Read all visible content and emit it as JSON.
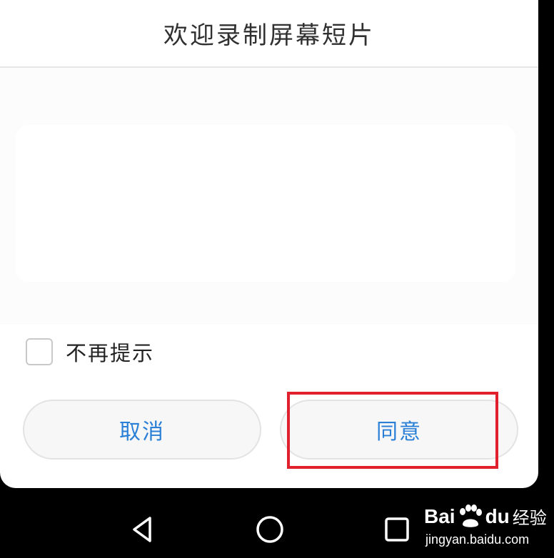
{
  "dialog": {
    "title": "欢迎录制屏幕短片",
    "checkbox": {
      "label": "不再提示",
      "checked": false
    },
    "buttons": {
      "cancel_label": "取消",
      "agree_label": "同意"
    },
    "button_text_color": "#2a7fd6",
    "highlight_color": "#e0202c"
  },
  "navbar": {
    "back_icon": "triangle-back-icon",
    "home_icon": "circle-home-icon",
    "recent_icon": "square-recent-apps-icon"
  },
  "watermark": {
    "brand_part1": "Bai",
    "brand_part2": "du",
    "product": "经验",
    "url": "jingyan.baidu.com"
  }
}
